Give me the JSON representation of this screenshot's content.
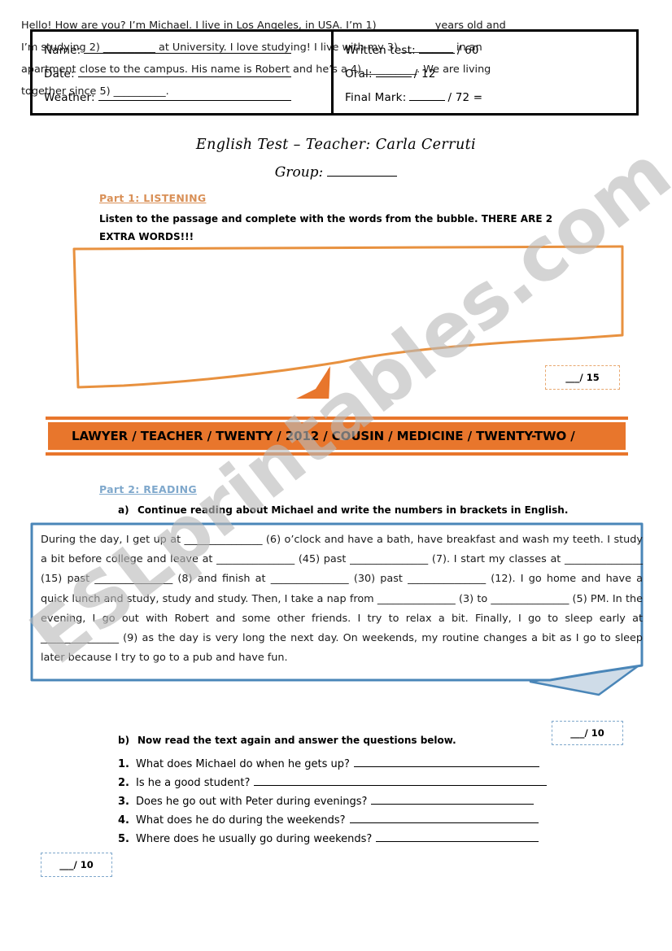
{
  "header": {
    "left_fields": [
      {
        "label": "Name:",
        "rule": "name"
      },
      {
        "label": "Date:",
        "rule": "date"
      },
      {
        "label": "Weather:",
        "rule": "weather"
      }
    ],
    "right_fields": [
      {
        "label": "Written test:",
        "suffix": "/ 60"
      },
      {
        "label": "Oral:",
        "suffix": "/ 12"
      },
      {
        "label": "Final Mark:",
        "suffix": "/ 72 ="
      }
    ]
  },
  "title": "English Test – Teacher: Carla Cerruti",
  "group_label": "Group:",
  "part1": {
    "heading": "Part 1: LISTENING",
    "instruction": "Listen to the passage and complete with the words from the bubble. THERE ARE 2 EXTRA WORDS!!!",
    "bubble_text": "Hello! How are you? I’m Michael. I live in Los Angeles, in USA. I’m 1) __________ years old and I’m studying 2) __________ at University. I love studying! I live with my 3) __________ in an apartment close to the campus. His name is Robert and he’s a 4) __________. We are living together since 5) __________.",
    "word_bank": "LAWYER / TEACHER / TWENTY / 2012 / COUSIN / MEDICINE / TWENTY-TWO /",
    "score": "___/ 15"
  },
  "part2": {
    "heading": "Part 2: READING",
    "a_letter": "a)",
    "a_instruction": "Continue reading about Michael and write the numbers in brackets in English.",
    "reading_text": "During the day, I get up at _______________ (6) o’clock and have a bath, have breakfast and wash my teeth. I study a bit before college and leave at _______________ (45) past _______________ (7). I start my classes at _______________ (15) past _______________ (8) and finish at _______________ (30) past _______________ (12). I go home and have a quick lunch and study, study and study. Then, I take a nap from _______________ (3) to _______________ (5) PM. In the evening, I go out with Robert and some other friends. I try to relax a bit. Finally, I go to sleep early at _______________ (9) as the day is very long the next day. On weekends, my routine changes a bit as I go to sleep later because I try to go to a pub and have fun.",
    "a_score": "___/ 10",
    "b_letter": "b)",
    "b_instruction": "Now read the text again and answer the questions below.",
    "questions": [
      {
        "num": "1.",
        "text": "What does Michael do when he gets up?",
        "rule_width": 228
      },
      {
        "num": "2.",
        "text": "Is he a good student?",
        "rule_width": 360
      },
      {
        "num": "3.",
        "text": "Does he go out with Peter during evenings?",
        "rule_width": 200
      },
      {
        "num": "4.",
        "text": "What does he do during the weekends?",
        "rule_width": 232
      },
      {
        "num": "5.",
        "text": "Where does he usually go during weekends?",
        "rule_width": 200
      }
    ],
    "b_score": "___/ 10"
  },
  "watermark": "ESLprintables.com",
  "colors": {
    "orange": "#E8762C",
    "orange_light": "#D99057",
    "blue": "#4A86B8",
    "blue_light": "#7FA8CC",
    "watermark_gray": "#b9b9b9"
  }
}
